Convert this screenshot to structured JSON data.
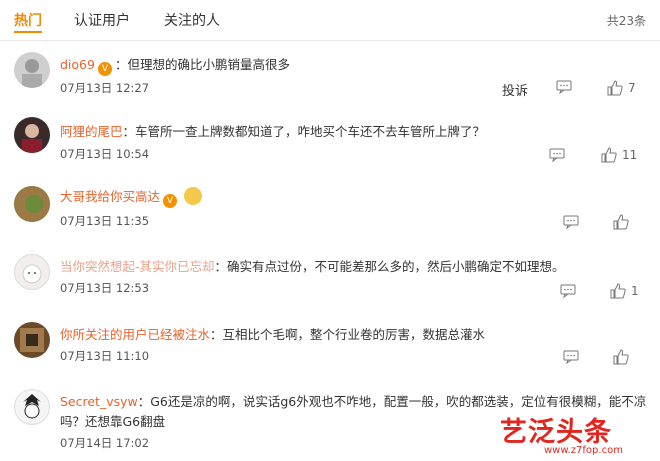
{
  "tabs": [
    {
      "label": "热门",
      "active": true
    },
    {
      "label": "认证用户",
      "active": false
    },
    {
      "label": "关注的人",
      "active": false
    }
  ],
  "total_count": "共23条",
  "report_label": "投诉",
  "comments": [
    {
      "author": "dio69",
      "text": "：但理想的确比小鹏销量高很多",
      "time": "07月13日 12:27",
      "likes": "7",
      "vip": true
    },
    {
      "author": "阿狸的尾巴",
      "text": "：车管所一查上牌数都知道了，咋地买个车还不去车管所上牌了？",
      "time": "07月13日 10:54",
      "likes": "11",
      "vip": false
    },
    {
      "author": "大哥我给你买高达",
      "text": "",
      "time": "07月13日 11:35",
      "likes": "",
      "vip": true
    },
    {
      "author": "当你突然想起-其实你已忘却",
      "text": "：确实有点过份，不可能差那么多的，然后小鹏确定不如理想。",
      "time": "07月13日 12:53",
      "likes": "1",
      "vip": false
    },
    {
      "author": "你所关注的用户已经被注水",
      "text": "：互相比个毛啊，整个行业卷的厉害，数据总灌水",
      "time": "07月13日 11:10",
      "likes": "",
      "vip": false
    },
    {
      "author": "Secret_vsyw",
      "text": "：G6还是凉的啊，说实话g6外观也不咋地，配置一般，吹的都选装，定位有很模糊，能不凉",
      "text2": "吗？还想靠G6翻盘",
      "time": "07月14日 17:02",
      "likes": "",
      "vip": false
    }
  ],
  "watermark": {
    "text": "艺泛头条",
    "url": "www.z7fop.com"
  },
  "colors": {
    "accent": "#f28a00",
    "username": "#e8632b",
    "watermark": "#e12620"
  }
}
